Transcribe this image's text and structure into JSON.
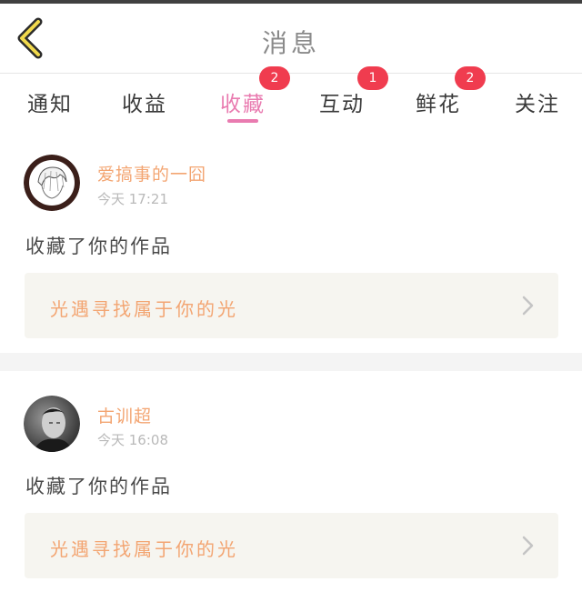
{
  "header": {
    "title": "消息"
  },
  "tabs": [
    {
      "label": "通知",
      "badge": ""
    },
    {
      "label": "收益",
      "badge": ""
    },
    {
      "label": "收藏",
      "badge": "2"
    },
    {
      "label": "互动",
      "badge": "1"
    },
    {
      "label": "鲜花",
      "badge": "2"
    },
    {
      "label": "关注",
      "badge": ""
    }
  ],
  "active_tab_index": 2,
  "messages": [
    {
      "username": "爱搞事的一囧",
      "time": "今天 17:21",
      "action": "收藏了你的作品",
      "work_title": "光遇寻找属于你的光"
    },
    {
      "username": "古训超",
      "time": "今天 16:08",
      "action": "收藏了你的作品",
      "work_title": "光遇寻找属于你的光"
    }
  ],
  "colors": {
    "accent_pink": "#e97bb0",
    "badge_red": "#f03c4f",
    "name_orange": "#f3a572",
    "back_yellow": "#f1d94c"
  }
}
